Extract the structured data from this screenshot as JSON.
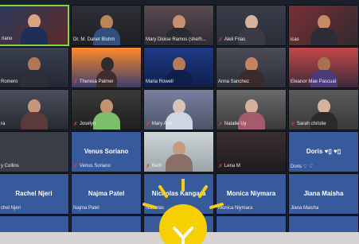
{
  "participants": [
    {
      "name": "Venus Soriano",
      "display": "riano",
      "muted": false
    },
    {
      "name": "Dr. M. Danet Bluhm",
      "display": "Dr. M. Danet Bluhm",
      "muted": false
    },
    {
      "name": "Mary Dioise Ramos (she/h...",
      "display": "Mary Dioise Ramos (she/h...",
      "muted": false
    },
    {
      "name": "Aleli Frias",
      "display": "Aleli Frias",
      "muted": true
    },
    {
      "name": "icas",
      "display": "icas",
      "muted": false
    },
    {
      "name": "Romero",
      "display": "Romero",
      "muted": false
    },
    {
      "name": "Theresa Palmer",
      "display": "Theresa Palmer",
      "muted": true
    },
    {
      "name": "Maria Rowell",
      "display": "Maria Rowell",
      "muted": false
    },
    {
      "name": "Anna Sanchez",
      "display": "Anna Sanchez",
      "muted": false
    },
    {
      "name": "Eleanor Mae Pascual",
      "display": "Eleanor Mae Pascual",
      "muted": false
    },
    {
      "name": "ra",
      "display": "ra",
      "muted": false
    },
    {
      "name": "Joselyn",
      "display": "Joselyn",
      "muted": true
    },
    {
      "name": "Mary Ann",
      "display": "Mary Ann",
      "muted": true
    },
    {
      "name": "Natalie Uy",
      "display": "Natalie Uy",
      "muted": true
    },
    {
      "name": "Sarah christie",
      "display": "Sarah christie",
      "muted": true
    },
    {
      "name": "y Collins",
      "display": "y Collins",
      "muted": false,
      "center": ""
    },
    {
      "name": "Venus Soriano",
      "display": "Venus Soriano",
      "muted": true,
      "center": "Venus Soriano"
    },
    {
      "name": "Beth",
      "display": "Beth",
      "muted": true
    },
    {
      "name": "Lena M",
      "display": "Lena M",
      "muted": true
    },
    {
      "name": "Doris ♡ ♡",
      "display": "Doris ♡ ♡",
      "muted": false,
      "center": "Doris ♥▯ ♥▯"
    },
    {
      "name": "chel Njeri",
      "display": "chel Njeri",
      "muted": false,
      "center": "Rachel Njeri"
    },
    {
      "name": "Najma Patel",
      "display": "Najma Patel",
      "muted": false,
      "center": "Najma Patel"
    },
    {
      "name": "Nicholas Kangara",
      "display": "Nicholas",
      "muted": false,
      "center": "Nicholas Kangara"
    },
    {
      "name": "Monica Niymara",
      "display": "Monica Niymara",
      "muted": false,
      "center": "Monica Niymara"
    },
    {
      "name": "Jiana Maisha",
      "display": "Jiana Maisha",
      "muted": false,
      "center": "Jiana Maisha"
    }
  ],
  "colors": {
    "active_border": "#7bd64a",
    "muted_icon": "#e23a3a",
    "blank_tile": "#365a9c",
    "bulb_yellow": "#f7d000"
  },
  "icons": {
    "muted": "mic-muted-icon",
    "bulb": "lightbulb-icon"
  }
}
